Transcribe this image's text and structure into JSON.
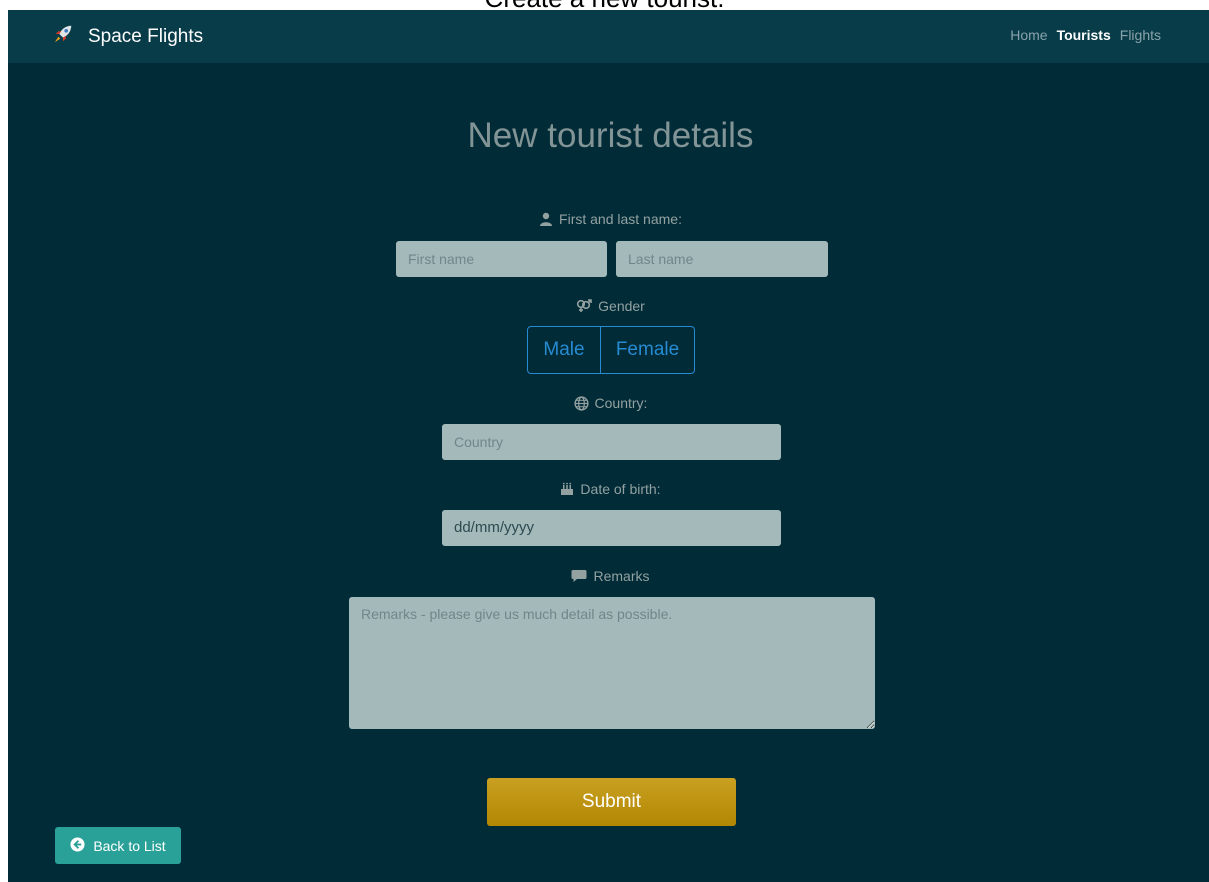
{
  "caption": "Create a new tourist.",
  "navbar": {
    "brand": "Space Flights",
    "brand_icon": "rocket-icon",
    "links": [
      {
        "label": "Home",
        "active": false
      },
      {
        "label": "Tourists",
        "active": true
      },
      {
        "label": "Flights",
        "active": false
      }
    ]
  },
  "form": {
    "title": "New tourist details",
    "name_label": "First and last name:",
    "first_name_placeholder": "First name",
    "last_name_placeholder": "Last name",
    "gender_label": "Gender",
    "gender_options": [
      "Male",
      "Female"
    ],
    "country_label": "Country:",
    "country_placeholder": "Country",
    "dob_label": "Date of birth:",
    "dob_value": "dd/mm/yyyy",
    "remarks_label": "Remarks",
    "remarks_placeholder": "Remarks - please give us much detail as possible.",
    "submit_label": "Submit"
  },
  "back_button": {
    "label": "Back to List",
    "icon": "arrow-left-circle-icon"
  },
  "colors": {
    "background": "#002b37",
    "navbar": "#073c48",
    "input": "#a4baba",
    "accent_blue": "#268bd2",
    "submit": "#b58900",
    "back": "#2aa198"
  }
}
